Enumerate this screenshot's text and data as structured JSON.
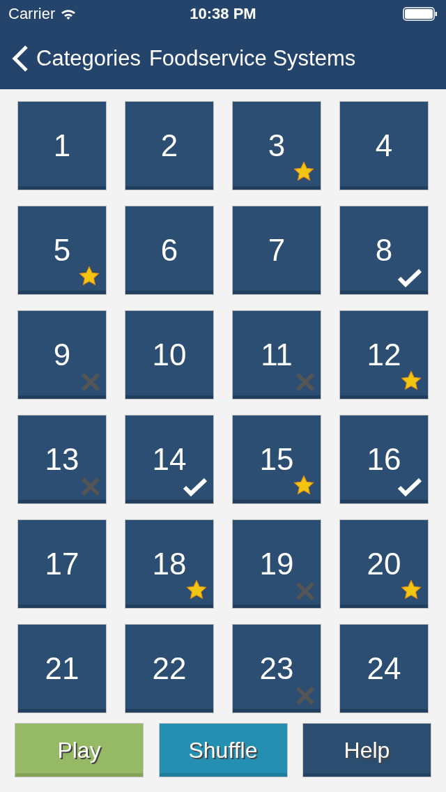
{
  "status_bar": {
    "carrier": "Carrier",
    "time": "10:38 PM"
  },
  "nav": {
    "back": "Categories",
    "title": "Foodservice Systems"
  },
  "tiles": [
    {
      "label": "1",
      "kind": "plain"
    },
    {
      "label": "2",
      "kind": "plain"
    },
    {
      "label": "3",
      "kind": "starred"
    },
    {
      "label": "4",
      "kind": "plain"
    },
    {
      "label": "5",
      "kind": "starred"
    },
    {
      "label": "6",
      "kind": "plain"
    },
    {
      "label": "7",
      "kind": "plain"
    },
    {
      "label": "8",
      "kind": "correct"
    },
    {
      "label": "9",
      "kind": "wrong"
    },
    {
      "label": "10",
      "kind": "plain"
    },
    {
      "label": "11",
      "kind": "wrong"
    },
    {
      "label": "12",
      "kind": "starred"
    },
    {
      "label": "13",
      "kind": "wrong"
    },
    {
      "label": "14",
      "kind": "correct"
    },
    {
      "label": "15",
      "kind": "starred"
    },
    {
      "label": "16",
      "kind": "correct"
    },
    {
      "label": "17",
      "kind": "plain"
    },
    {
      "label": "18",
      "kind": "starred"
    },
    {
      "label": "19",
      "kind": "wrong"
    },
    {
      "label": "20",
      "kind": "starred"
    },
    {
      "label": "21",
      "kind": "plain"
    },
    {
      "label": "22",
      "kind": "plain"
    },
    {
      "label": "23",
      "kind": "wrong"
    },
    {
      "label": "24",
      "kind": "plain"
    }
  ],
  "buttons": [
    {
      "label": "Play",
      "color": "#96b965"
    },
    {
      "label": "Shuffle",
      "color": "#258fb1"
    },
    {
      "label": "Help",
      "color": "#2b4d70"
    }
  ]
}
